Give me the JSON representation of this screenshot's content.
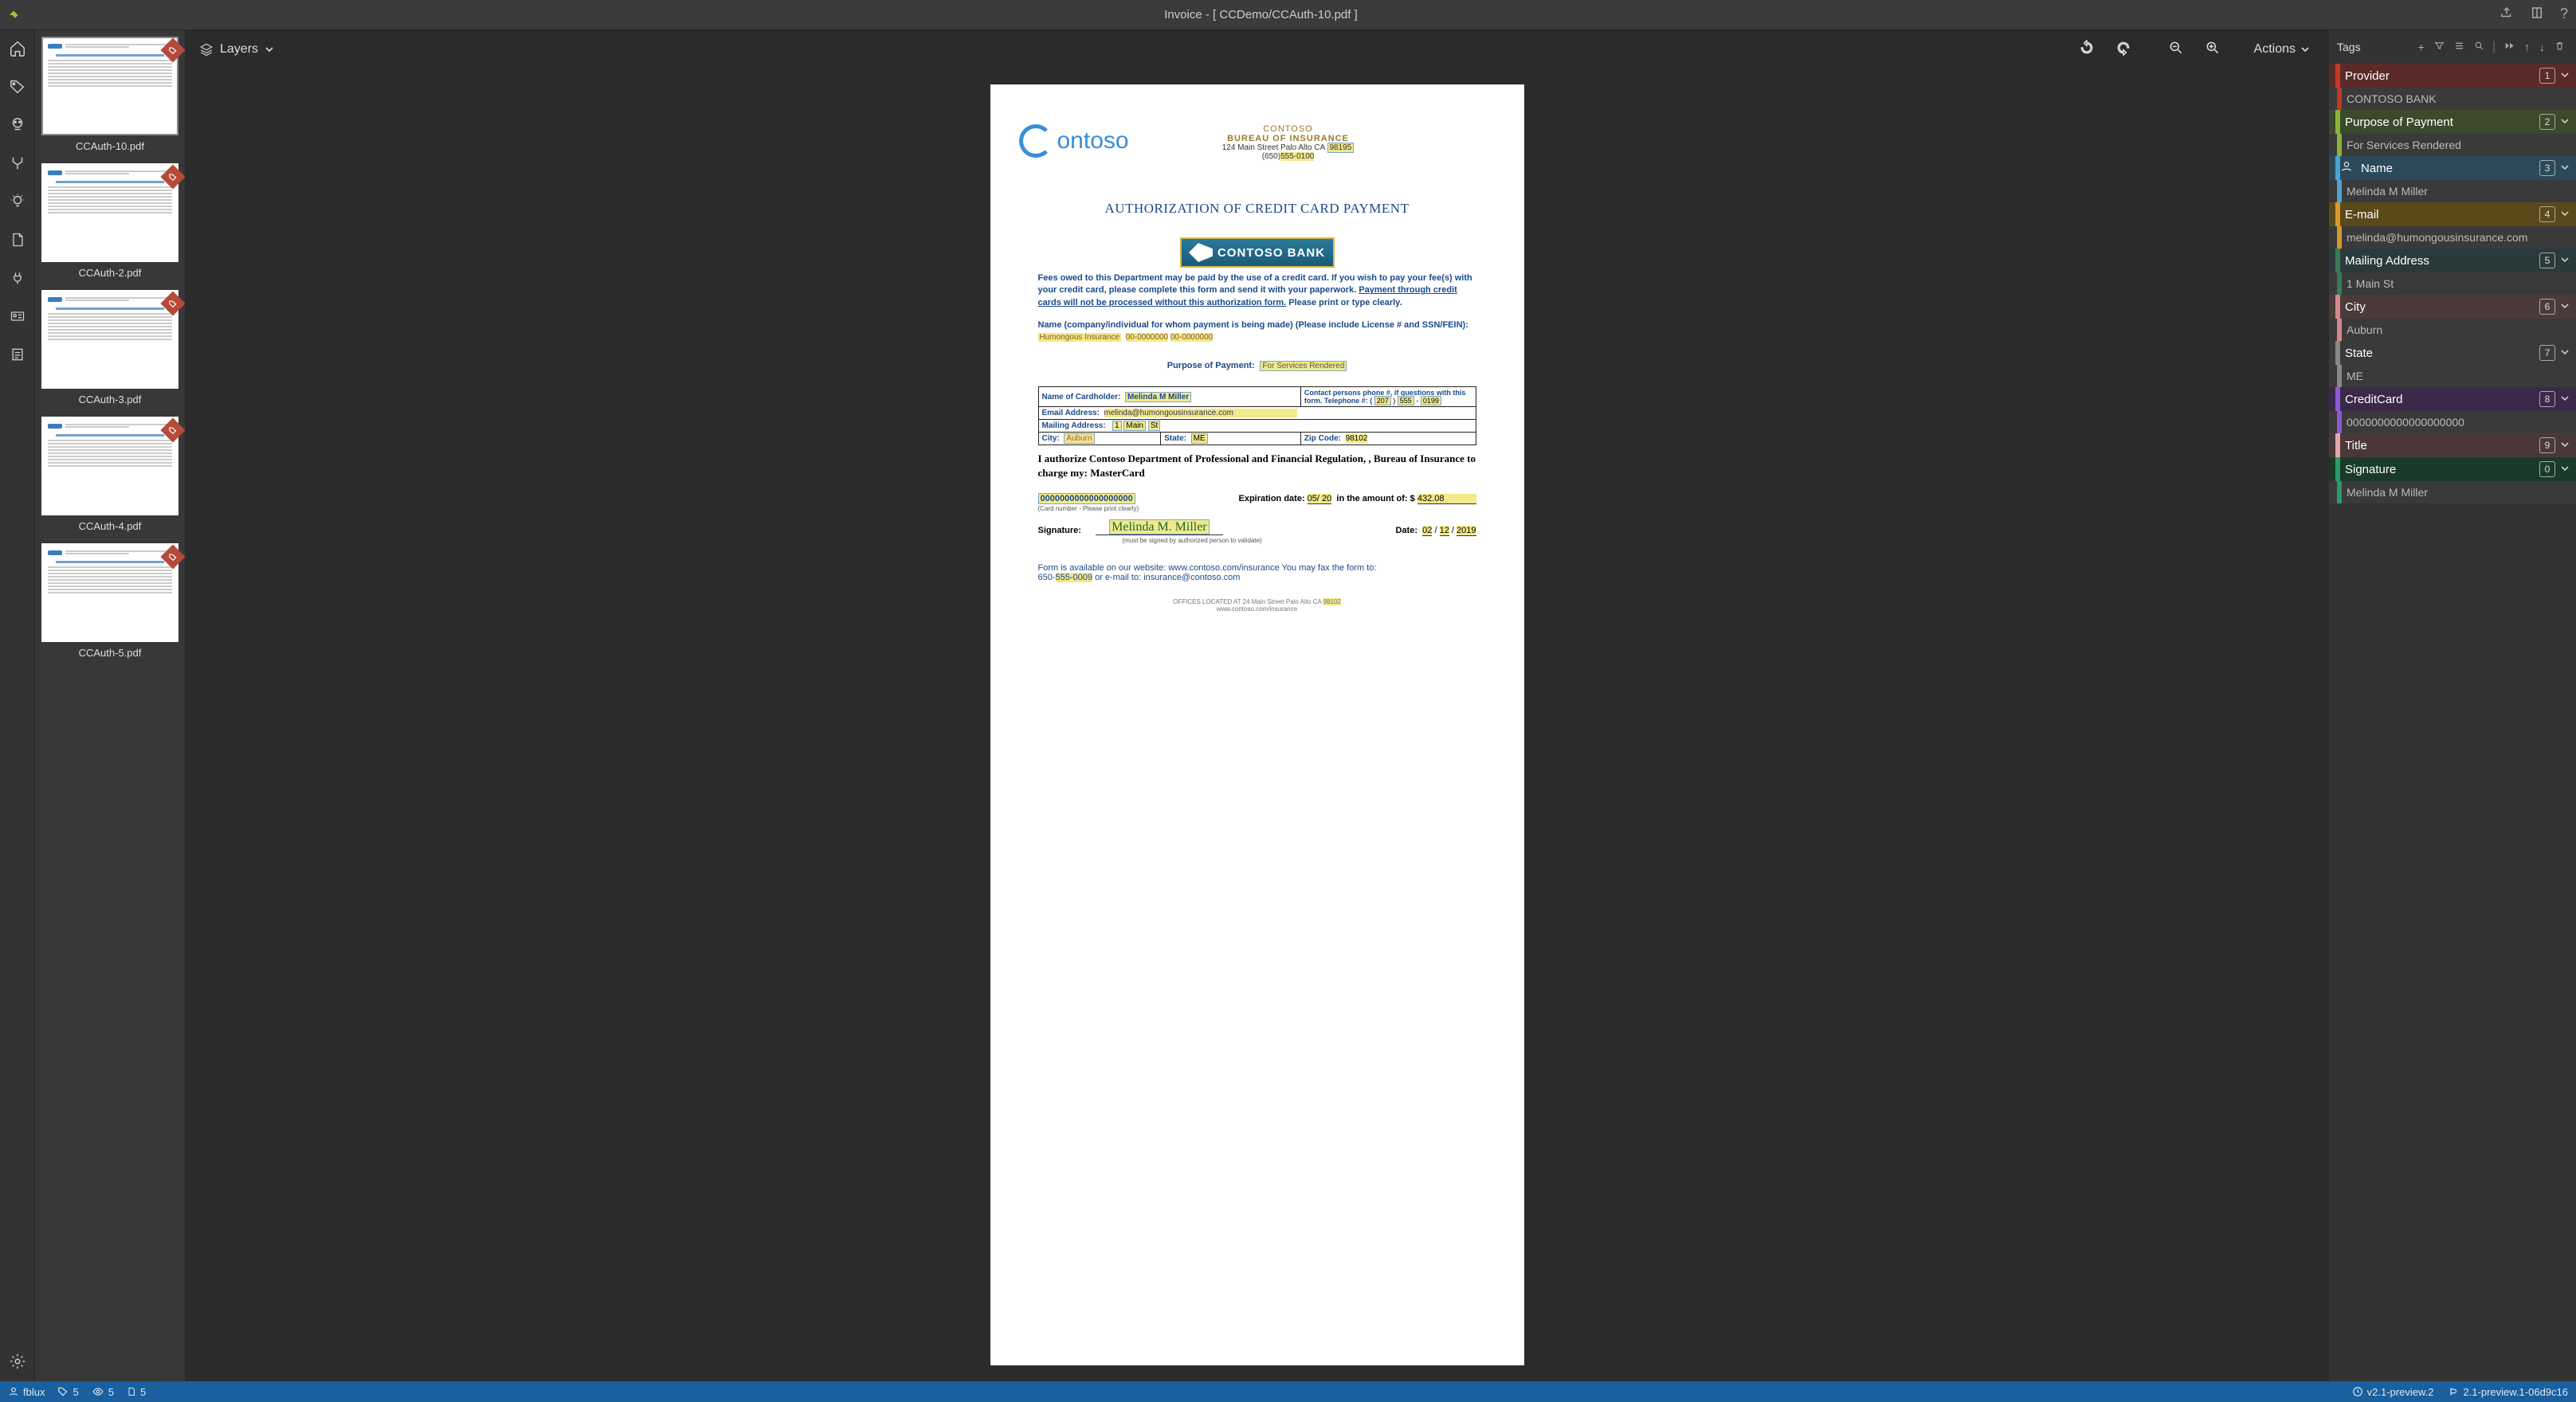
{
  "titlebar": {
    "title": "Invoice - [ CCDemo/CCAuth-10.pdf ]"
  },
  "toolbar": {
    "layers": "Layers",
    "actions": "Actions"
  },
  "thumbnails": [
    {
      "label": "CCAuth-10.pdf",
      "selected": true
    },
    {
      "label": "CCAuth-2.pdf",
      "selected": false
    },
    {
      "label": "CCAuth-3.pdf",
      "selected": false
    },
    {
      "label": "CCAuth-4.pdf",
      "selected": false
    },
    {
      "label": "CCAuth-5.pdf",
      "selected": false
    }
  ],
  "doc": {
    "hdr_l1": "CONTOSO",
    "hdr_l2": "BUREAU OF INSURANCE",
    "hdr_l3_a": "124 Main Street Palo Alto CA ",
    "hdr_l3_b": "98195",
    "hdr_l4_a": "(650)",
    "hdr_l4_b": "555-0100",
    "title": "AUTHORIZATION OF CREDIT CARD PAYMENT",
    "bank": "CONTOSO BANK",
    "para1": "Fees owed to this Department may be paid by the use of a credit card.  If you wish to pay your fee(s) with your credit card, please complete this form and send it with your paperwork.  ",
    "para1_u": "Payment through credit cards will not be processed without this authorization form.",
    "para1_end": "  Please print or type clearly.",
    "name_lbl": "Name (company/individual for whom payment is being made) (Please include License # and SSN/FEIN):",
    "name_val": "Humongous Insurance   00-0000000  00-0000000",
    "purpose_lbl": "Purpose of Payment:",
    "purpose_val": "For Services Rendered",
    "tbl": {
      "cardholder_lbl": "Name of Cardholder:",
      "cardholder_val": "Melinda M Miller",
      "contact_lbl": "Contact persons phone #, if questions with this form. Telephone #: (",
      "ph_a": "207",
      "ph_b": "555",
      "ph_c": "0199",
      "email_lbl": "Email Address:",
      "email_val": "melinda@humongousinsurance.com",
      "mail_lbl": "Mailing Address:",
      "mail_val": "1 Main St",
      "city_lbl": "City:",
      "city_val": "Auburn",
      "state_lbl": "State:",
      "state_val": "ME",
      "zip_lbl": "Zip Code:",
      "zip_val": "98102"
    },
    "auth": "I authorize Contoso Department of Professional and Financial Regulation, , Bureau of Insurance to charge my:   MasterCard",
    "cc_num": "0000000000000000000",
    "cc_hint": "(Card number - Please print clearly)",
    "exp_lbl": "Expiration date:",
    "exp_val": "05/ 20",
    "amt_lbl": "in the amount of: $",
    "amt_val": "432.08",
    "sig_lbl": "Signature:",
    "sig_val": "Melinda M. Miller",
    "sig_hint": "(must be signed by authorized person to validate)",
    "date_lbl": "Date:",
    "date_m": "02",
    "date_d": "12",
    "date_y": "2019",
    "footer_a": "Form is available on our website:  www.contoso.com/insurance You may fax the form to:",
    "footer_b_a": "650-",
    "footer_b_b": "555-0009",
    "footer_b_c": "  or e-mail to:  insurance@contoso.com",
    "office_a": "OFFICES LOCATED AT 24 Main Street Palo Alto CA ",
    "office_b": "98102",
    "office_c": "www.contoso.com/insurance"
  },
  "tags_panel": {
    "title": "Tags",
    "items": [
      {
        "name": "Provider",
        "num": "1",
        "value": "CONTOSO BANK",
        "color": "#c0392b",
        "bg": "#5a2a28",
        "icon": false
      },
      {
        "name": "Purpose of Payment",
        "num": "2",
        "value": "For Services Rendered",
        "color": "#8bb33a",
        "bg": "#3a4a2a",
        "icon": false
      },
      {
        "name": "Name",
        "num": "3",
        "value": "Melinda M Miller",
        "color": "#4aa5d4",
        "bg": "#2a4a5a",
        "icon": true
      },
      {
        "name": "E-mail",
        "num": "4",
        "value": "melinda@humongousinsurance.com",
        "color": "#d69a2a",
        "bg": "#5a4a1a",
        "icon": false
      },
      {
        "name": "Mailing Address",
        "num": "5",
        "value": "1 Main St",
        "color": "#3a7a5a",
        "bg": "#2a3a3a",
        "icon": false
      },
      {
        "name": "City",
        "num": "6",
        "value": "Auburn",
        "color": "#d4888a",
        "bg": "#4a3a3a",
        "icon": false
      },
      {
        "name": "State",
        "num": "7",
        "value": "ME",
        "color": "#888",
        "bg": "#3a3a3a",
        "icon": false
      },
      {
        "name": "CreditCard",
        "num": "8",
        "value": "0000000000000000000",
        "color": "#8a5ad4",
        "bg": "#3a2a4a",
        "icon": false
      },
      {
        "name": "Title",
        "num": "9",
        "value": null,
        "color": "#e4a5a5",
        "bg": "#4a3838",
        "icon": false
      },
      {
        "name": "Signature",
        "num": "0",
        "value": "Melinda M Miller",
        "color": "#2a9a6a",
        "bg": "#1a3a2a",
        "icon": false
      }
    ]
  },
  "statusbar": {
    "user": "fblux",
    "tag_count": "5",
    "eye_count": "5",
    "doc_count": "5",
    "ver_a": "v2.1-preview.2",
    "ver_b": "2.1-preview.1-06d9c16"
  }
}
